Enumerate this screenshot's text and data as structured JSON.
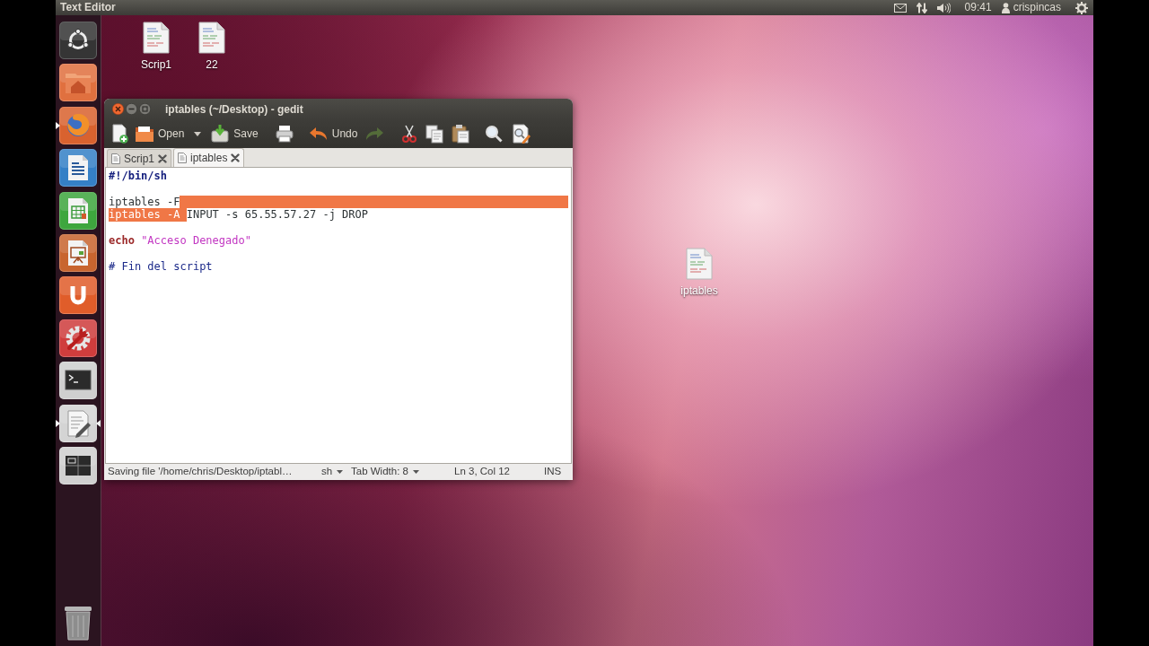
{
  "top_panel": {
    "app_title": "Text Editor",
    "clock": "09:41",
    "user": "crispincas"
  },
  "launcher": {
    "items": [
      {
        "kind": "dash",
        "running": false,
        "focused": false
      },
      {
        "kind": "files",
        "running": false,
        "focused": false
      },
      {
        "kind": "browser",
        "running": true,
        "focused": false
      },
      {
        "kind": "writer",
        "running": false,
        "focused": false
      },
      {
        "kind": "calc",
        "running": false,
        "focused": false
      },
      {
        "kind": "impress",
        "running": false,
        "focused": false
      },
      {
        "kind": "cloud",
        "running": false,
        "focused": false
      },
      {
        "kind": "settings",
        "running": false,
        "focused": false
      },
      {
        "kind": "terminal",
        "running": false,
        "focused": false
      },
      {
        "kind": "editor",
        "running": true,
        "focused": true
      },
      {
        "kind": "workspaces",
        "running": false,
        "focused": false
      },
      {
        "kind": "trash",
        "running": false,
        "focused": false
      }
    ]
  },
  "desktop_icons": [
    {
      "label": "Scrip1"
    },
    {
      "label": "22"
    },
    {
      "label": "iptables"
    }
  ],
  "window": {
    "title": "iptables (~/Desktop) - gedit",
    "toolbar": [
      {
        "kind": "new",
        "disabled": false
      },
      {
        "kind": "open",
        "label": "Open",
        "disabled": false
      },
      {
        "kind": "menu",
        "disabled": false
      },
      {
        "kind": "save",
        "label": "Save",
        "disabled": false
      },
      {
        "kind": "print",
        "disabled": false
      },
      {
        "kind": "undo",
        "label": "Undo",
        "disabled": false
      },
      {
        "kind": "redo",
        "disabled": true
      },
      {
        "kind": "cut",
        "disabled": false
      },
      {
        "kind": "copy",
        "disabled": false
      },
      {
        "kind": "paste",
        "disabled": false
      },
      {
        "kind": "find",
        "disabled": false
      },
      {
        "kind": "replace",
        "disabled": false
      }
    ],
    "tabs": [
      {
        "label": "Scrip1",
        "selected": false
      },
      {
        "label": "iptables",
        "selected": true
      }
    ],
    "editor": {
      "lines": [
        {
          "tokens": [
            {
              "text": "#!/bin/sh",
              "kind": "shebang",
              "selected": false
            }
          ],
          "eol_selected": false
        },
        {
          "eol_selected": false
        },
        {
          "tokens": [
            {
              "text": "iptables -F",
              "kind": "plain",
              "selected": false
            }
          ],
          "eol_selected": true
        },
        {
          "tokens": [
            {
              "text": "iptables -A ",
              "kind": "plain",
              "selected": true
            },
            {
              "text": "INPUT -s 65.55.57.27 -j DROP",
              "kind": "plain",
              "selected": false
            }
          ],
          "eol_selected": false
        },
        {
          "eol_selected": false
        },
        {
          "tokens": [
            {
              "text": "echo ",
              "kind": "keyword",
              "selected": false
            },
            {
              "text": "\"Acceso Denegado\"",
              "kind": "string",
              "selected": false
            }
          ],
          "eol_selected": false
        },
        {
          "eol_selected": false
        },
        {
          "tokens": [
            {
              "text": "# Fin del script",
              "kind": "comment",
              "selected": false
            }
          ],
          "eol_selected": false
        }
      ]
    },
    "status_bar": {
      "message": "Saving file '/home/chris/Desktop/iptabl…",
      "language": "sh",
      "tab_width": "Tab Width: 8",
      "position": "Ln 3, Col 12",
      "mode": "INS"
    }
  }
}
